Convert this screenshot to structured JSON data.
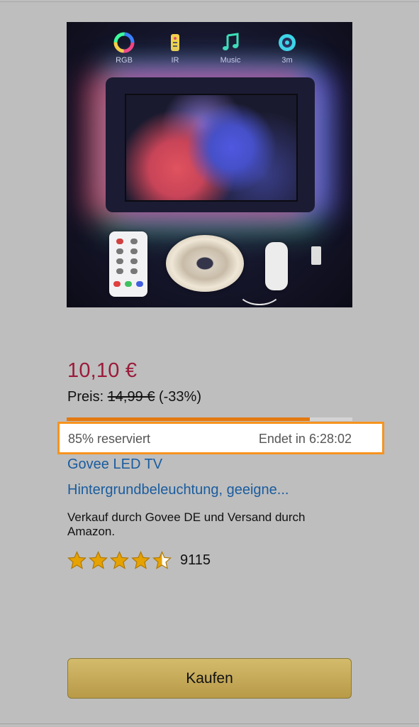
{
  "product": {
    "image_features": [
      {
        "label": "RGB",
        "icon": "color-wheel-icon"
      },
      {
        "label": "IR",
        "icon": "remote-icon"
      },
      {
        "label": "Music",
        "icon": "music-note-icon"
      },
      {
        "label": "3m",
        "icon": "light-strip-icon"
      }
    ],
    "price": "10,10 €",
    "list_price_label": "Preis:",
    "list_price": "14,99 €",
    "discount": "(-33%)",
    "title_line1": "Govee LED TV",
    "title_line2": "Hintergrundbeleuchtung, geeigne...",
    "seller_text": "Verkauf durch Govee DE und Versand durch Amazon.",
    "rating_stars": 4.5,
    "review_count": "9115"
  },
  "deal": {
    "reserved_text": "85% reserviert",
    "reserved_fraction": 0.85,
    "ends_text": "Endet in 6:28:02"
  },
  "buy": {
    "label": "Kaufen"
  },
  "colors": {
    "price": "#9b1b3a",
    "link": "#1a5c9e",
    "progress": "#e47911",
    "highlight_border": "#f7931e",
    "button": "#c9ad5c",
    "star": "#e6a200"
  }
}
